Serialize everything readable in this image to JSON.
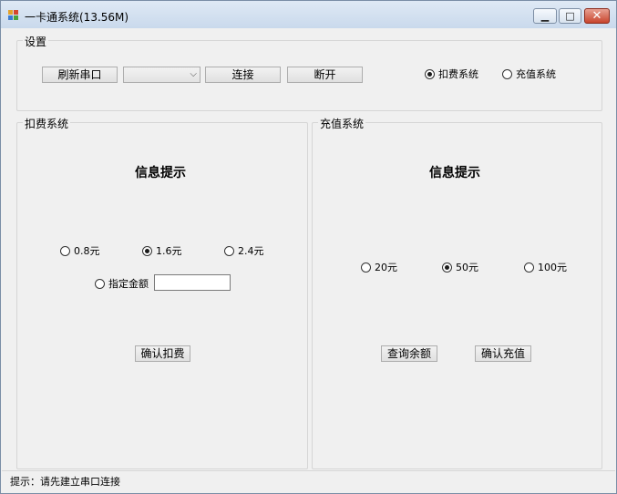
{
  "window": {
    "title": "一卡通系统(13.56M)",
    "controls": {
      "minimize": "▁",
      "maximize": "□",
      "close": "✕"
    }
  },
  "settings": {
    "title": "设置",
    "refresh_label": "刷新串口",
    "port_value": "",
    "connect_label": "连接",
    "disconnect_label": "断开",
    "mode_options": [
      {
        "label": "扣费系统",
        "checked": true
      },
      {
        "label": "充值系统",
        "checked": false
      }
    ]
  },
  "deduct": {
    "title": "扣费系统",
    "heading": "信息提示",
    "amounts": [
      {
        "label": "0.8元",
        "checked": false
      },
      {
        "label": "1.6元",
        "checked": true
      },
      {
        "label": "2.4元",
        "checked": false
      }
    ],
    "custom_label": "指定金额",
    "custom_value": "",
    "confirm_label": "确认扣费"
  },
  "recharge": {
    "title": "充值系统",
    "heading": "信息提示",
    "amounts": [
      {
        "label": "20元",
        "checked": false
      },
      {
        "label": "50元",
        "checked": true
      },
      {
        "label": "100元",
        "checked": false
      }
    ],
    "query_label": "查询余额",
    "confirm_label": "确认充值"
  },
  "status": {
    "text": "提示：请先建立串口连接"
  }
}
